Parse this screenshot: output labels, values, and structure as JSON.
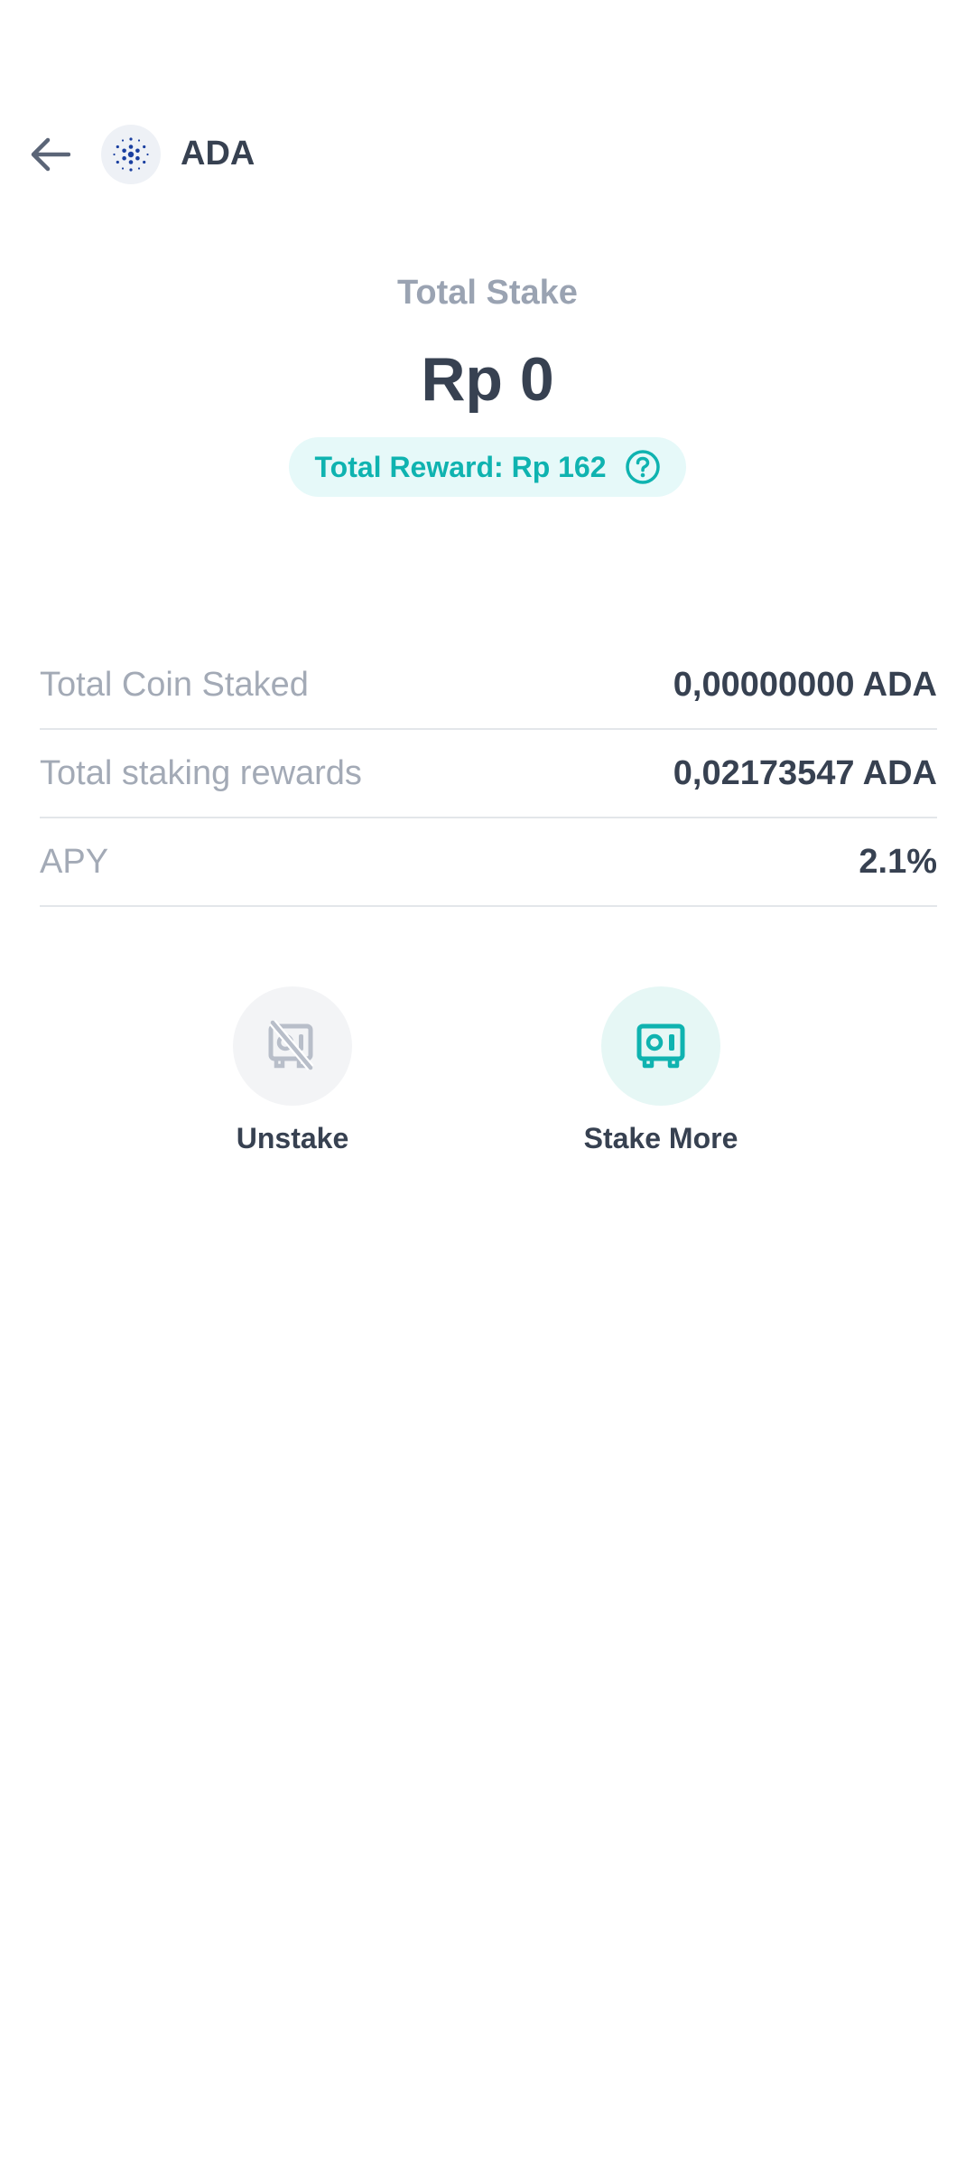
{
  "header": {
    "back_icon": "arrow-left-icon",
    "coin_icon": "cardano-icon",
    "coin_name": "ADA"
  },
  "summary": {
    "total_stake_label": "Total Stake",
    "total_stake_value": "Rp 0",
    "total_reward_text": "Total Reward: Rp 162",
    "help_icon": "question-circle-icon"
  },
  "details": [
    {
      "label": "Total Coin Staked",
      "value": "0,00000000 ADA"
    },
    {
      "label": "Total staking rewards",
      "value": "0,02173547 ADA"
    },
    {
      "label": "APY",
      "value": "2.1%"
    }
  ],
  "actions": {
    "unstake": {
      "label": "Unstake",
      "icon": "unstake-safe-icon",
      "enabled": false
    },
    "stake_more": {
      "label": "Stake More",
      "icon": "safe-icon",
      "enabled": true
    }
  },
  "colors": {
    "accent": "#0fb3b0",
    "text_primary": "#374151",
    "text_muted": "#9aa3b2",
    "divider": "#e3e6ea"
  }
}
